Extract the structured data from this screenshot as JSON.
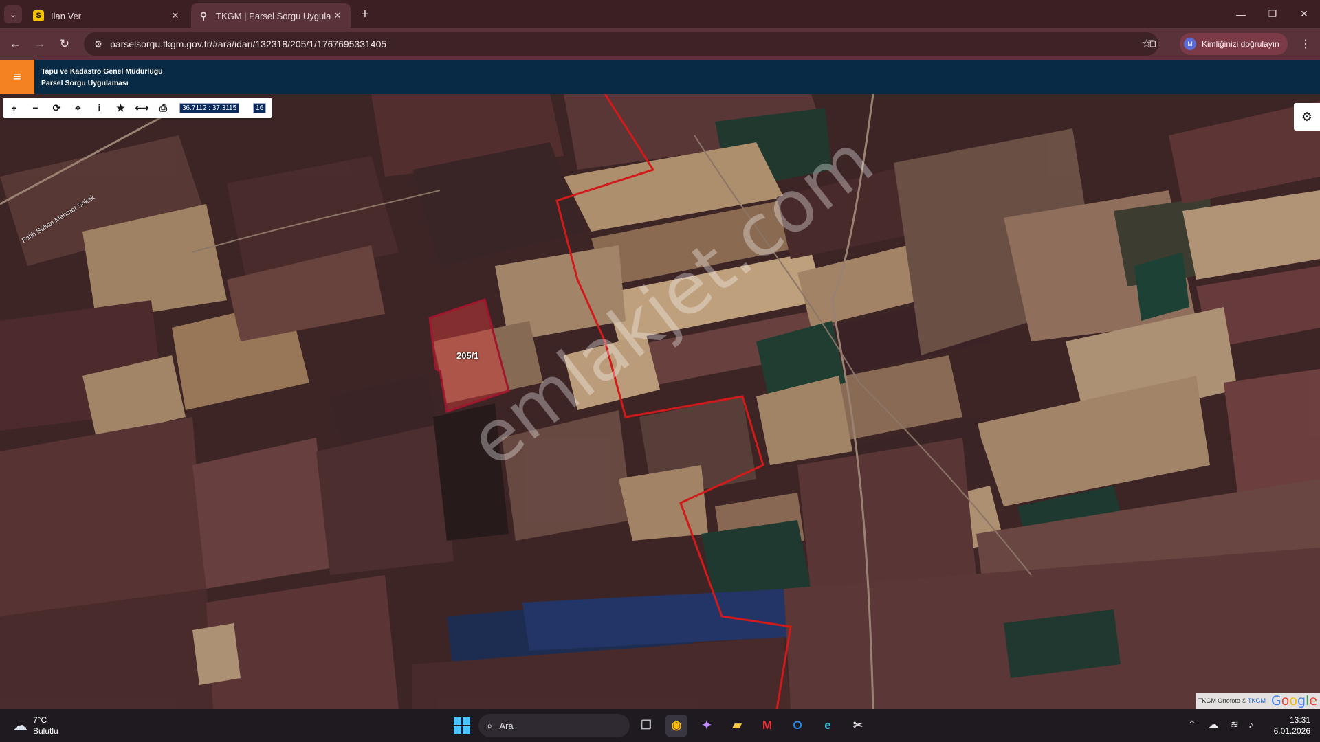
{
  "browser": {
    "tabs": [
      {
        "title": "İlan Ver",
        "favicon": "S",
        "active": false
      },
      {
        "title": "TKGM | Parsel Sorgu Uygulaması",
        "favicon": "pin-icon",
        "active": true
      }
    ],
    "url": "parselsorgu.tkgm.gov.tr/#ara/idari/132318/205/1/1767695331405",
    "profile_initial": "M",
    "profile_label": "Kimliğinizi doğrulayın"
  },
  "app": {
    "org_name": "Tapu ve Kadastro Genel Müdürlüğü",
    "app_name": "Parsel Sorgu Uygulaması",
    "brand_color": "#f48221",
    "header_color": "#082a45"
  },
  "map": {
    "coordinates": "36.7112 : 37.3115",
    "zoom_level": "16",
    "parcel_label": "205/1",
    "street_label": "Fatih Sultan Mehmet Sokak",
    "watermark": "emlakjet.com",
    "attribution_text": "TKGM Ortofoto ©",
    "attribution_link": "TKGM",
    "google_logo": "Google",
    "parcel_outline_color": "#d11a1a"
  },
  "taskbar": {
    "temperature": "7°C",
    "weather": "Bulutlu",
    "search_label": "Ara",
    "time": "13:31",
    "date": "6.01.2026"
  }
}
